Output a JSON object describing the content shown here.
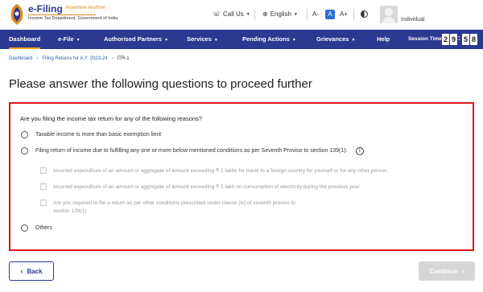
{
  "header": {
    "logo": {
      "title": "e-Filing",
      "tagline": "Anywhere Anytime",
      "subtitle": "Income Tax Department, Government of India"
    },
    "call_us": "Call Us",
    "language": "English",
    "font_sizes": [
      "A-",
      "A",
      "A+"
    ],
    "user_role": "Individual"
  },
  "nav": {
    "items": [
      {
        "label": "Dashboard",
        "active": true,
        "dropdown": false
      },
      {
        "label": "e-File",
        "active": false,
        "dropdown": true
      },
      {
        "label": "Authorised Partners",
        "active": false,
        "dropdown": true
      },
      {
        "label": "Services",
        "active": false,
        "dropdown": true
      },
      {
        "label": "Pending Actions",
        "active": false,
        "dropdown": true
      },
      {
        "label": "Grievances",
        "active": false,
        "dropdown": true
      },
      {
        "label": "Help",
        "active": false,
        "dropdown": false
      }
    ],
    "session_label": "Session Time",
    "session_time": [
      "2",
      "9",
      "5",
      "8"
    ]
  },
  "breadcrumb": {
    "items": [
      "Dashboard",
      "Filing Returns for A.Y. 2023-24"
    ],
    "current": "ITR-1"
  },
  "page_title": "Please answer the following questions to proceed further",
  "form": {
    "question": "Are you filing the income tax return for any of the following reasons?",
    "options": [
      "Taxable income is more than basic exemption limit",
      "Filing return of income due to fulfilling any one or more below mentioned conditions as per Seventh Proviso to section 139(1):",
      "Others"
    ],
    "sub_options": [
      [
        "Incurred expenditure of an amount or aggregate of amount exceeding ₹ 2 lakhs for travel to a foreign country for yourself or for any other person;"
      ],
      [
        "Incurred expenditure of an amount or aggregate of amount exceeding ₹ 1 lakh on consumption of electricity during the previous year"
      ],
      [
        "Are you required to file a return as per other conditions prescribed under clause (iv) of seventh proviso to",
        "section 139(1)"
      ]
    ]
  },
  "buttons": {
    "back": "Back",
    "continue": "Continue"
  },
  "colors": {
    "nav_bg": "#2b3990",
    "highlight_border": "#e0151b",
    "active_underline": "#f5a623"
  }
}
